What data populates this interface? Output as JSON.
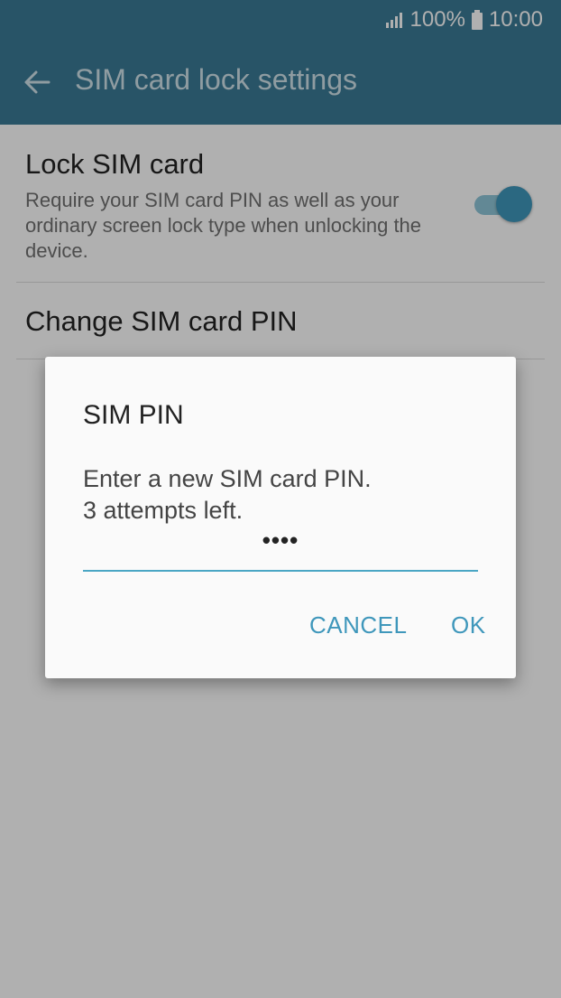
{
  "status_bar": {
    "battery_percent": "100%",
    "time": "10:00",
    "icons": [
      "signal-icon",
      "battery-icon"
    ]
  },
  "app_bar": {
    "title": "SIM card lock settings",
    "back_icon": "arrow-left-icon"
  },
  "settings": {
    "lock_sim": {
      "title": "Lock SIM card",
      "summary": "Require your SIM card PIN as well as your ordinary screen lock type when unlocking the device.",
      "enabled": true
    },
    "change_pin": {
      "title": "Change SIM card PIN"
    }
  },
  "dialog": {
    "title": "SIM PIN",
    "message_line1": "Enter a new SIM card PIN.",
    "message_line2": "3 attempts left.",
    "pin_value": "••••",
    "cancel_label": "CANCEL",
    "ok_label": "OK"
  },
  "colors": {
    "app_bar": "#3a7a95",
    "accent": "#3f97bb",
    "scrim": "rgba(0,0,0,0.31)"
  }
}
